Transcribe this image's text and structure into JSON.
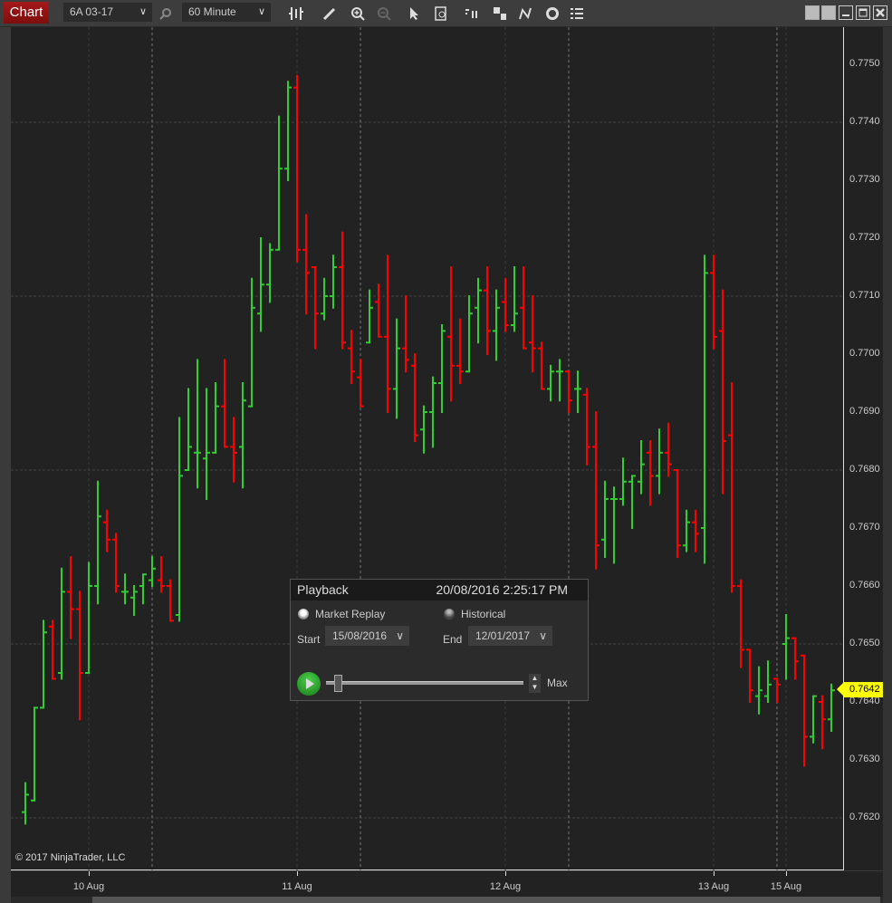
{
  "toolbar": {
    "tab_label": "Chart",
    "instrument": "6A 03-17",
    "interval": "60 Minute",
    "icons": [
      "search-icon",
      "bar-type-icon",
      "pencil-icon",
      "zoom-in-icon",
      "zoom-out-icon",
      "pointer-icon",
      "data-box-icon",
      "strategies-icon",
      "templates-icon",
      "drawing-tools-icon",
      "reload-icon",
      "properties-list-icon"
    ],
    "window_controls": [
      "link-button",
      "link-button-2",
      "minimize-icon",
      "maximize-icon",
      "close-icon"
    ]
  },
  "chart": {
    "copyright": "© 2017 NinjaTrader, LLC",
    "last_price": "0.7642",
    "up_color": "#32cd32",
    "down_color": "#ff0000",
    "background": "#222222",
    "last_price_color": "#ffff00"
  },
  "playback": {
    "title": "Playback",
    "datetime": "20/08/2016 2:25:17 PM",
    "mode_market_replay": "Market Replay",
    "mode_historical": "Historical",
    "selected_mode": "Market Replay",
    "start_label": "Start",
    "start_date": "15/08/2016",
    "end_label": "End",
    "end_date": "12/01/2017",
    "speed_label": "Max",
    "slider_fraction": 0.04
  },
  "chart_data": {
    "type": "ohlc",
    "ylim": [
      0.7614,
      0.7759
    ],
    "y_ticks": [
      "0.7750",
      "0.7740",
      "0.7730",
      "0.7720",
      "0.7710",
      "0.7700",
      "0.7690",
      "0.7680",
      "0.7670",
      "0.7660",
      "0.7650",
      "0.7640",
      "0.7630",
      "0.7620"
    ],
    "y_grid": [
      0.774,
      0.771,
      0.768,
      0.765,
      0.762
    ],
    "x_ticks": [
      {
        "label": "10 Aug",
        "bar": 7
      },
      {
        "label": "11 Aug",
        "bar": 30
      },
      {
        "label": "12 Aug",
        "bar": 53
      },
      {
        "label": "13 Aug",
        "bar": 76
      },
      {
        "label": "15 Aug",
        "bar": 84
      }
    ],
    "session_breaks": [
      14,
      37,
      60,
      83
    ],
    "grid": true,
    "bars_ohlc": [
      [
        0.7621,
        0.7626,
        0.7619,
        0.7624
      ],
      [
        0.7623,
        0.7639,
        0.7623,
        0.7639
      ],
      [
        0.7639,
        0.7654,
        0.7639,
        0.7652
      ],
      [
        0.7653,
        0.7654,
        0.7644,
        0.7644
      ],
      [
        0.7645,
        0.7663,
        0.7644,
        0.7659
      ],
      [
        0.7659,
        0.7665,
        0.7651,
        0.7656
      ],
      [
        0.7656,
        0.7659,
        0.7637,
        0.7645
      ],
      [
        0.7645,
        0.7664,
        0.7645,
        0.766
      ],
      [
        0.766,
        0.7678,
        0.7657,
        0.7672
      ],
      [
        0.7671,
        0.7673,
        0.7666,
        0.7668
      ],
      [
        0.7668,
        0.7669,
        0.7659,
        0.766
      ],
      [
        0.7659,
        0.7662,
        0.7657,
        0.7659
      ],
      [
        0.7658,
        0.766,
        0.7655,
        0.7659
      ],
      [
        0.766,
        0.7662,
        0.7657,
        0.7662
      ],
      [
        0.7661,
        0.7665,
        0.766,
        0.7663
      ],
      [
        0.7661,
        0.7665,
        0.7659,
        0.766
      ],
      [
        0.766,
        0.7661,
        0.7654,
        0.7654
      ],
      [
        0.7655,
        0.7689,
        0.7654,
        0.7679
      ],
      [
        0.768,
        0.7694,
        0.768,
        0.7684
      ],
      [
        0.7683,
        0.7699,
        0.7677,
        0.7683
      ],
      [
        0.7682,
        0.7694,
        0.7675,
        0.7683
      ],
      [
        0.7683,
        0.7695,
        0.7683,
        0.7691
      ],
      [
        0.7691,
        0.7699,
        0.7684,
        0.7684
      ],
      [
        0.7684,
        0.7689,
        0.7678,
        0.7683
      ],
      [
        0.7684,
        0.7695,
        0.7677,
        0.7692
      ],
      [
        0.7691,
        0.7713,
        0.7691,
        0.7708
      ],
      [
        0.7707,
        0.772,
        0.7704,
        0.7712
      ],
      [
        0.7712,
        0.7719,
        0.7709,
        0.7718
      ],
      [
        0.7718,
        0.7741,
        0.7718,
        0.7732
      ],
      [
        0.7732,
        0.7747,
        0.773,
        0.7746
      ],
      [
        0.7746,
        0.7748,
        0.7716,
        0.7718
      ],
      [
        0.7718,
        0.7724,
        0.7707,
        0.7714
      ],
      [
        0.7715,
        0.7715,
        0.7701,
        0.7707
      ],
      [
        0.7707,
        0.7713,
        0.7706,
        0.771
      ],
      [
        0.771,
        0.7717,
        0.7708,
        0.7715
      ],
      [
        0.7715,
        0.7721,
        0.7701,
        0.7702
      ],
      [
        0.7701,
        0.7704,
        0.7695,
        0.7697
      ],
      [
        0.7696,
        0.7699,
        0.7691,
        0.7691
      ],
      [
        0.7702,
        0.7711,
        0.7702,
        0.7708
      ],
      [
        0.7709,
        0.7712,
        0.7703,
        0.7703
      ],
      [
        0.7703,
        0.7717,
        0.769,
        0.7694
      ],
      [
        0.7694,
        0.7706,
        0.7689,
        0.7701
      ],
      [
        0.7701,
        0.771,
        0.7697,
        0.7699
      ],
      [
        0.7698,
        0.77,
        0.7685,
        0.7686
      ],
      [
        0.7687,
        0.7691,
        0.7683,
        0.769
      ],
      [
        0.769,
        0.7696,
        0.7684,
        0.7695
      ],
      [
        0.7695,
        0.7705,
        0.769,
        0.7704
      ],
      [
        0.7703,
        0.7715,
        0.7692,
        0.7698
      ],
      [
        0.7698,
        0.7706,
        0.7695,
        0.7697
      ],
      [
        0.7697,
        0.771,
        0.7697,
        0.7707
      ],
      [
        0.7708,
        0.7713,
        0.7702,
        0.7711
      ],
      [
        0.7711,
        0.7715,
        0.77,
        0.7704
      ],
      [
        0.7704,
        0.7711,
        0.7699,
        0.7708
      ],
      [
        0.7709,
        0.7713,
        0.7704,
        0.7705
      ],
      [
        0.7705,
        0.7715,
        0.7704,
        0.7707
      ],
      [
        0.7708,
        0.7715,
        0.7701,
        0.7701
      ],
      [
        0.7702,
        0.771,
        0.7697,
        0.7701
      ],
      [
        0.7701,
        0.7702,
        0.7694,
        0.7694
      ],
      [
        0.7694,
        0.7698,
        0.7692,
        0.7697
      ],
      [
        0.7697,
        0.7699,
        0.7692,
        0.7697
      ],
      [
        0.7697,
        0.7697,
        0.769,
        0.7692
      ],
      [
        0.7694,
        0.7697,
        0.769,
        0.7694
      ],
      [
        0.7693,
        0.7694,
        0.7681,
        0.7684
      ],
      [
        0.7684,
        0.769,
        0.7663,
        0.7667
      ],
      [
        0.7668,
        0.7678,
        0.7665,
        0.7675
      ],
      [
        0.7675,
        0.7677,
        0.7664,
        0.7675
      ],
      [
        0.7675,
        0.7682,
        0.7674,
        0.7678
      ],
      [
        0.7678,
        0.7679,
        0.767,
        0.7679
      ],
      [
        0.7678,
        0.7685,
        0.7676,
        0.7681
      ],
      [
        0.7683,
        0.7685,
        0.7674,
        0.7679
      ],
      [
        0.7679,
        0.7687,
        0.7676,
        0.7683
      ],
      [
        0.7683,
        0.7688,
        0.7679,
        0.7681
      ],
      [
        0.768,
        0.768,
        0.7665,
        0.7667
      ],
      [
        0.7667,
        0.7673,
        0.7666,
        0.7671
      ],
      [
        0.7671,
        0.7673,
        0.7666,
        0.7669
      ],
      [
        0.767,
        0.7717,
        0.7664,
        0.7714
      ],
      [
        0.7714,
        0.7717,
        0.7701,
        0.7703
      ],
      [
        0.7704,
        0.7711,
        0.7676,
        0.7685
      ],
      [
        0.7686,
        0.7695,
        0.7659,
        0.766
      ],
      [
        0.766,
        0.7661,
        0.7646,
        0.7649
      ],
      [
        0.7649,
        0.7649,
        0.764,
        0.7642
      ],
      [
        0.7641,
        0.7646,
        0.7638,
        0.7642
      ],
      [
        0.7641,
        0.7647,
        0.764,
        0.7643
      ],
      [
        0.7644,
        0.7644,
        0.764,
        0.7643
      ],
      [
        0.765,
        0.7655,
        0.7644,
        0.7651
      ],
      [
        0.7651,
        0.7651,
        0.7644,
        0.7647
      ],
      [
        0.7648,
        0.7648,
        0.7629,
        0.7634
      ],
      [
        0.7634,
        0.7641,
        0.7633,
        0.7641
      ],
      [
        0.764,
        0.7641,
        0.7632,
        0.7637
      ],
      [
        0.7637,
        0.7643,
        0.7635,
        0.7642
      ]
    ]
  }
}
